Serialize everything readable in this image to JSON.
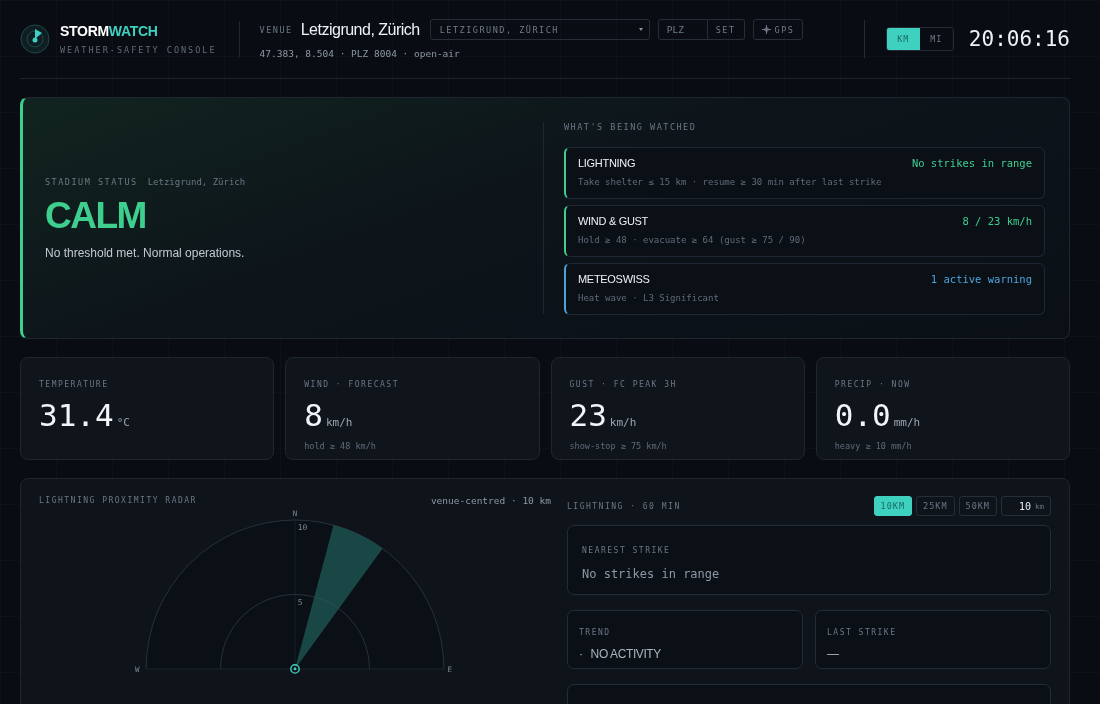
{
  "header": {
    "brand": [
      "STORM",
      "WATCH"
    ],
    "subtitle": "WEATHER-SAFETY CONSOLE",
    "venue_label": "VENUE",
    "venue_name": "Letzigrund, Zürich",
    "venue_meta": "47.383, 8.504 · PLZ 8004 · open-air",
    "venue_select": {
      "value": "LETZIGRUND, ZÜRICH"
    },
    "plz_field": {
      "placeholder": "PLZ"
    },
    "set_button": "SET",
    "gps_button": "GPS",
    "units": [
      {
        "label": "KM",
        "selected": true
      },
      {
        "label": "MI",
        "selected": false
      }
    ],
    "clock": "20:06:16"
  },
  "status": {
    "label": "STADIUM STATUS",
    "location": "Letzigrund, Zürich",
    "headline": "CALM",
    "kind": "calm",
    "message": "No threshold met. Normal operations.",
    "watched_title": "WHAT'S BEING WATCHED",
    "watched": [
      {
        "name": "LIGHTNING",
        "detail": "Take shelter ≤ 15 km · resume ≥ 30 min after last strike",
        "reading": "No strikes in range",
        "color": "#3ecf8e"
      },
      {
        "name": "WIND & GUST",
        "detail": "Hold ≥ 48 · evacuate ≥ 64 (gust ≥ 75 / 90)",
        "reading": "8 / 23 km/h",
        "color": "#3ecf8e"
      },
      {
        "name": "METEOSWISS",
        "detail": "Heat wave · L3 Significant",
        "reading": "1 active warning",
        "color": "#4da3d9"
      }
    ]
  },
  "metrics": [
    {
      "label": "TEMPERATURE",
      "value": "31.4",
      "unit": "°C"
    },
    {
      "label": "WIND · FORECAST",
      "value": "8",
      "unit": "km/h",
      "note": "hold ≥ 48 km/h"
    },
    {
      "label": "GUST · FC PEAK 3H",
      "value": "23",
      "unit": "km/h",
      "note": "show-stop ≥ 75 km/h"
    },
    {
      "label": "PRECIP · NOW",
      "value": "0.0",
      "unit": "mm/h",
      "note": "heavy ≥ 10 mm/h"
    }
  ],
  "radar": {
    "title": "LIGHTNING PROXIMITY RADAR",
    "meta": "venue-centred · 10 km",
    "north": "N",
    "west": "W",
    "east": "E",
    "rings": [
      "10",
      "5"
    ]
  },
  "lightning": {
    "title": "LIGHTNING · 60 MIN",
    "ranges": [
      {
        "label": "10KM",
        "selected": true
      },
      {
        "label": "25KM",
        "selected": false
      },
      {
        "label": "50KM",
        "selected": false
      }
    ],
    "range_input": {
      "value": "10",
      "unit": "km"
    },
    "nearest": {
      "label": "NEAREST STRIKE",
      "value": "No strikes in range"
    },
    "trend": {
      "label": "TREND",
      "bullet": "·",
      "value": "NO ACTIVITY"
    },
    "last_strike": {
      "label": "LAST STRIKE",
      "value": "—"
    }
  }
}
